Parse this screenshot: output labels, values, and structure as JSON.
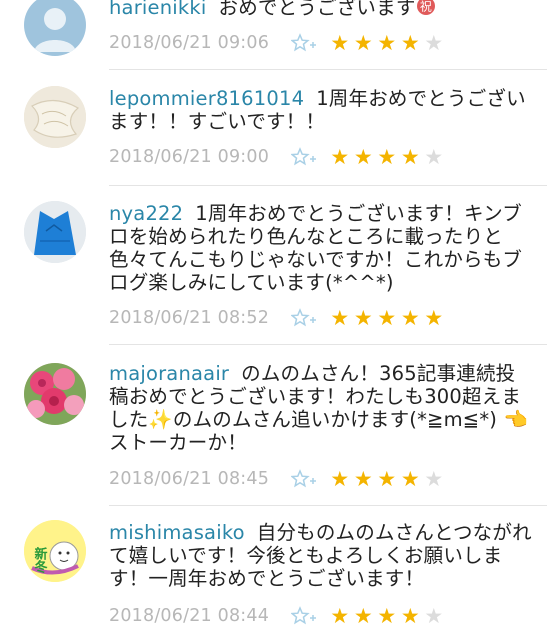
{
  "comments": [
    {
      "username": "harienikki",
      "text": "おめでとうございます",
      "emoji": "祝",
      "date": "2018/06/21 09:06",
      "rating": 4,
      "avatar": "default-user-icon"
    },
    {
      "username": "lepommier8161014",
      "text": "1周年おめでとうございます！！すごいです！！",
      "date": "2018/06/21 09:00",
      "rating": 4,
      "avatar": "cream-fabric-photo"
    },
    {
      "username": "nya222",
      "text": "1周年おめでとうございます！キンブロを始められたり色んなところに載ったりと色々てんこもりじゃないですか！これからもブログ楽しみにしています(*^^*)",
      "date": "2018/06/21 08:52",
      "rating": 5,
      "avatar": "blue-dress-photo"
    },
    {
      "username": "majoranaair",
      "text_before": "のムのムさん！365記事連続投稿おめでとうございます！わたしも300超えました",
      "sparkle": "✨",
      "text_after": "のムのムさん追いかけます(*≧m≦*) 👈ストーカーか！",
      "date": "2018/06/21 08:45",
      "rating": 4,
      "avatar": "pink-roses-photo"
    },
    {
      "username": "mishimasaiko",
      "text": "自分ものムのムさんとつながれて嬉しいです！今後ともよろしくお願いします！一周年おめでとうございます！",
      "date": "2018/06/21 08:44",
      "rating": 4,
      "avatar": "shinto-character-badge",
      "badge_text": "新冬"
    }
  ],
  "max_rating": 5,
  "colors": {
    "username": "#2a86a8",
    "date": "#b7b7b7",
    "star_on": "#f4b400",
    "star_off": "#dcdcdc",
    "fav_icon": "#a9d0e6"
  }
}
